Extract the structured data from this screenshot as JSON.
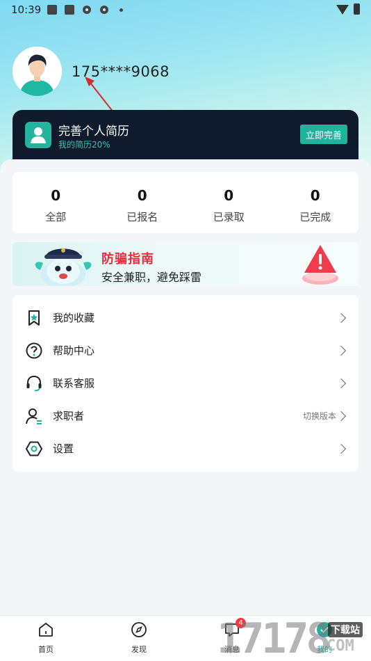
{
  "status_bar": {
    "time": "10:39"
  },
  "profile": {
    "phone": "175****9068"
  },
  "resume": {
    "title": "完善个人简历",
    "subtitle": "我的简历20%",
    "button": "立即完善"
  },
  "stats": [
    {
      "value": "0",
      "label": "全部"
    },
    {
      "value": "0",
      "label": "已报名"
    },
    {
      "value": "0",
      "label": "已录取"
    },
    {
      "value": "0",
      "label": "已完成"
    }
  ],
  "fraud_banner": {
    "title": "防骗指南",
    "subtitle": "安全兼职，避免踩雷"
  },
  "menu": [
    {
      "label": "我的收藏",
      "icon": "bookmark-icon"
    },
    {
      "label": "帮助中心",
      "icon": "help-icon"
    },
    {
      "label": "联系客服",
      "icon": "headset-icon"
    },
    {
      "label": "求职者",
      "icon": "user-switch-icon",
      "extra": "切换版本"
    },
    {
      "label": "设置",
      "icon": "settings-icon"
    }
  ],
  "bottom_nav": [
    {
      "label": "首页",
      "icon": "home-icon"
    },
    {
      "label": "发现",
      "icon": "compass-icon"
    },
    {
      "label": "消息",
      "icon": "message-icon",
      "badge": "4"
    },
    {
      "label": "我的",
      "icon": "profile-icon"
    }
  ],
  "watermark": {
    "number": "17178",
    "site": "下载站",
    "domain": "COM"
  },
  "colors": {
    "accent": "#21b29d",
    "dark_card": "#0f1b2d",
    "danger": "#ef2a3a"
  }
}
